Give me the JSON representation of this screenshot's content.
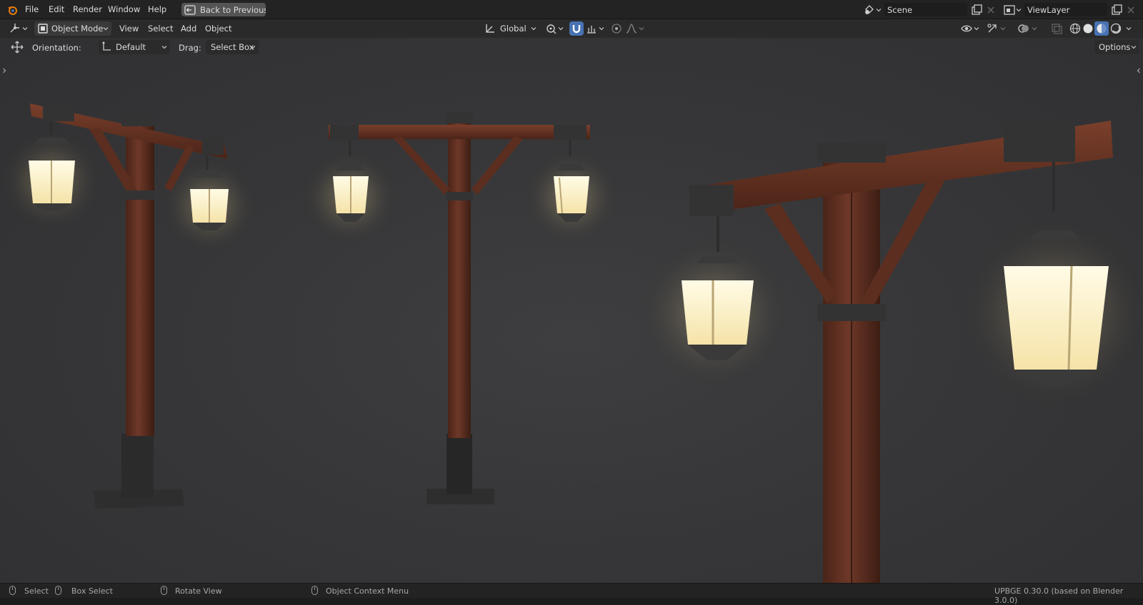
{
  "topbar": {
    "menu": [
      "File",
      "Edit",
      "Render",
      "Window",
      "Help"
    ],
    "back_button": "Back to Previous",
    "scene_name": "Scene",
    "view_layer_name": "ViewLayer"
  },
  "header": {
    "mode": "Object Mode",
    "menus": [
      "View",
      "Select",
      "Add",
      "Object"
    ],
    "transform_orientation": "Global",
    "options_label": "Options"
  },
  "tool_settings": {
    "orientation_label": "Orientation:",
    "orientation_value": "Default",
    "drag_label": "Drag:",
    "drag_value": "Select Box"
  },
  "status": {
    "select": "Select",
    "box_select": "Box Select",
    "rotate_view": "Rotate View",
    "context_menu": "Object Context Menu",
    "version": "UPBGE 0.30.0 (based on Blender 3.0.0)"
  },
  "icons": {
    "app": "blender-logo-icon",
    "back": "back-arrow-icon",
    "editor_type": "3d-viewport-icon",
    "mode": "object-mode-icon",
    "orientation": "transform-orientation-icon",
    "pivot": "pivot-point-icon",
    "snap": "snap-magnet-icon",
    "proportional": "proportional-editing-icon",
    "visibility": "eye-icon",
    "gizmo": "gizmo-icon",
    "overlay": "overlay-icon",
    "xray": "xray-icon",
    "shading": [
      "wireframe-shading-icon",
      "solid-shading-icon",
      "material-preview-icon",
      "rendered-shading-icon"
    ],
    "move_tool": "move-tool-icon"
  },
  "colors": {
    "accent_blue": "#4772b3",
    "wood": "#6b3524",
    "lamp_glow": "#fff3c4"
  }
}
